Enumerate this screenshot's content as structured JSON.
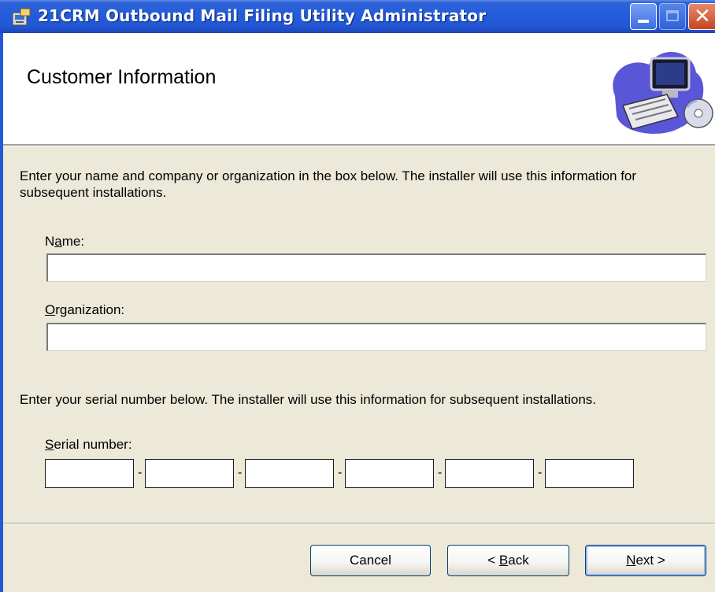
{
  "window": {
    "title": "21CRM Outbound Mail Filing Utility Administrator",
    "icon": "installer-icon",
    "controls": {
      "minimize": "minimize-icon",
      "maximize": "maximize-icon",
      "close": "close-icon"
    }
  },
  "banner": {
    "title": "Customer Information",
    "art": "computer-cd-icon"
  },
  "intro": {
    "text": "Enter your name and company or organization in the box below. The installer will use this information for subsequent installations."
  },
  "name_field": {
    "label_pre": "N",
    "label_accel": "a",
    "label_post": "me:",
    "value": ""
  },
  "org_field": {
    "label_pre": "",
    "label_accel": "O",
    "label_post": "rganization:",
    "value": ""
  },
  "serial": {
    "intro": "Enter your serial number below. The installer will use this information for subsequent installations.",
    "label_pre": "",
    "label_accel": "S",
    "label_post": "erial number:",
    "separator": "-",
    "segments": [
      "",
      "",
      "",
      "",
      "",
      ""
    ]
  },
  "buttons": {
    "cancel": {
      "label": "Cancel"
    },
    "back": {
      "pre": "< ",
      "accel": "B",
      "post": "ack"
    },
    "next": {
      "pre": "",
      "accel": "N",
      "post": "ext >"
    }
  },
  "colors": {
    "titlebar": "#245ddb",
    "face": "#ece9d8",
    "close": "#c94420"
  }
}
